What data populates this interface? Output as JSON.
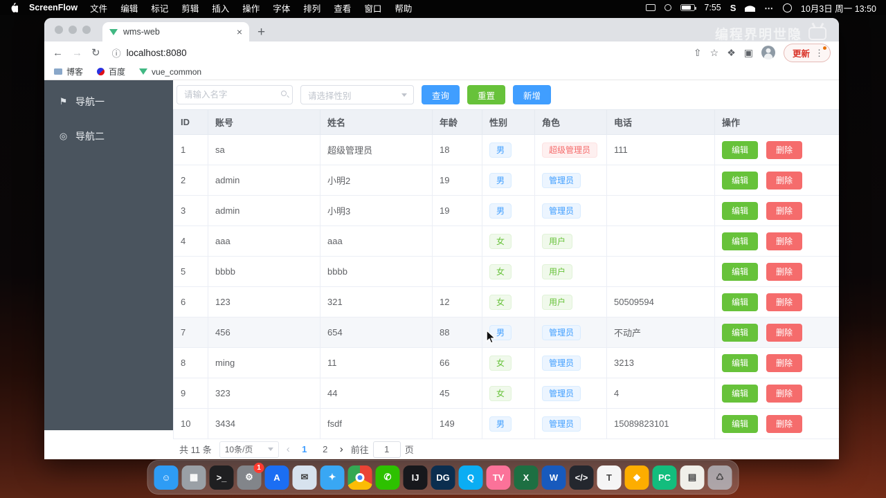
{
  "colors": {
    "primary": "#409eff",
    "success": "#67c23a",
    "danger": "#f56c6c",
    "sidebar_bg": "#4a545e",
    "header_bg": "#eef1f6"
  },
  "menubar": {
    "app_name": "ScreenFlow",
    "menus": [
      "文件",
      "编辑",
      "标记",
      "剪辑",
      "插入",
      "操作",
      "字体",
      "排列",
      "查看",
      "窗口",
      "帮助"
    ],
    "right": {
      "battery_time": "7:55",
      "screenflow_badge": "S",
      "datetime": "10月3日 周一  13:50"
    }
  },
  "browser": {
    "tab": {
      "title": "wms-web"
    },
    "url": "localhost:8080",
    "update_label": "更新",
    "bookmarks": [
      {
        "label": "博客"
      },
      {
        "label": "百度"
      },
      {
        "label": "vue_common"
      }
    ],
    "watermark": "编程界明世隐"
  },
  "sidebar": {
    "items": [
      {
        "label": "导航一",
        "icon": "flag-icon"
      },
      {
        "label": "导航二",
        "icon": "location-icon"
      }
    ]
  },
  "toolbar": {
    "name_placeholder": "请输入名字",
    "gender_placeholder": "请选择性别",
    "search_label": "查询",
    "reset_label": "重置",
    "add_label": "新增"
  },
  "table": {
    "headers": [
      "ID",
      "账号",
      "姓名",
      "年龄",
      "性别",
      "角色",
      "电话",
      "操作"
    ],
    "edit_label": "编辑",
    "delete_label": "删除",
    "rows": [
      {
        "id": "1",
        "account": "sa",
        "name": "超级管理员",
        "age": "18",
        "gender": "男",
        "gender_type": "primary",
        "role": "超级管理员",
        "role_type": "danger",
        "phone": "111"
      },
      {
        "id": "2",
        "account": "admin",
        "name": "小明2",
        "age": "19",
        "gender": "男",
        "gender_type": "primary",
        "role": "管理员",
        "role_type": "primary",
        "phone": ""
      },
      {
        "id": "3",
        "account": "admin",
        "name": "小明3",
        "age": "19",
        "gender": "男",
        "gender_type": "primary",
        "role": "管理员",
        "role_type": "primary",
        "phone": ""
      },
      {
        "id": "4",
        "account": "aaa",
        "name": "aaa",
        "age": "",
        "gender": "女",
        "gender_type": "success",
        "role": "用户",
        "role_type": "success",
        "phone": ""
      },
      {
        "id": "5",
        "account": "bbbb",
        "name": "bbbb",
        "age": "",
        "gender": "女",
        "gender_type": "success",
        "role": "用户",
        "role_type": "success",
        "phone": ""
      },
      {
        "id": "6",
        "account": "123",
        "name": "321",
        "age": "12",
        "gender": "女",
        "gender_type": "success",
        "role": "用户",
        "role_type": "success",
        "phone": "50509594"
      },
      {
        "id": "7",
        "account": "456",
        "name": "654",
        "age": "88",
        "gender": "男",
        "gender_type": "primary",
        "role": "管理员",
        "role_type": "primary",
        "phone": "不动产",
        "hover": true
      },
      {
        "id": "8",
        "account": "ming",
        "name": "11",
        "age": "66",
        "gender": "女",
        "gender_type": "success",
        "role": "管理员",
        "role_type": "primary",
        "phone": "3213"
      },
      {
        "id": "9",
        "account": "323",
        "name": "44",
        "age": "45",
        "gender": "女",
        "gender_type": "success",
        "role": "管理员",
        "role_type": "primary",
        "phone": "4"
      },
      {
        "id": "10",
        "account": "3434",
        "name": "fsdf",
        "age": "149",
        "gender": "男",
        "gender_type": "primary",
        "role": "管理员",
        "role_type": "primary",
        "phone": "15089823101"
      }
    ]
  },
  "pagination": {
    "total_label": "共 11 条",
    "page_size_label": "10条/页",
    "pages": [
      "1",
      "2"
    ],
    "active_page": "1",
    "goto_label": "前往",
    "goto_value": "1",
    "unit_label": "页"
  },
  "dock": {
    "icons": [
      {
        "name": "finder",
        "color": "#2e9cf5",
        "glyph": "☺"
      },
      {
        "name": "launchpad",
        "color": "#9aa0a6",
        "glyph": "▦"
      },
      {
        "name": "terminal",
        "color": "#1f1f21",
        "glyph": ">_"
      },
      {
        "name": "system-preferences",
        "color": "#82858a",
        "glyph": "⚙",
        "badge": "1"
      },
      {
        "name": "app-store",
        "color": "#1b6ef3",
        "glyph": "A"
      },
      {
        "name": "mail",
        "color": "#d7e2ee",
        "glyph": "✉",
        "light": true
      },
      {
        "name": "safari",
        "color": "#39a7f4",
        "glyph": "✦"
      },
      {
        "name": "chrome",
        "color": "",
        "glyph": ""
      },
      {
        "name": "wechat",
        "color": "#2dc100",
        "glyph": "✆"
      },
      {
        "name": "intellij-idea",
        "color": "#17181c",
        "glyph": "IJ"
      },
      {
        "name": "datagrip",
        "color": "#0b2e4f",
        "glyph": "DG"
      },
      {
        "name": "qq",
        "color": "#0badf3",
        "glyph": "Q"
      },
      {
        "name": "bilibili",
        "color": "#fb7299",
        "glyph": "TV"
      },
      {
        "name": "excel",
        "color": "#1d6f42",
        "glyph": "X"
      },
      {
        "name": "word",
        "color": "#185abd",
        "glyph": "W"
      },
      {
        "name": "vscode",
        "color": "#24272e",
        "glyph": "</>"
      },
      {
        "name": "typora",
        "color": "#f5f5f5",
        "glyph": "T",
        "light": true
      },
      {
        "name": "sketch",
        "color": "#fdad00",
        "glyph": "◆"
      },
      {
        "name": "pycharm",
        "color": "#13bd7d",
        "glyph": "PC"
      },
      {
        "name": "notes",
        "color": "#f0efe9",
        "glyph": "▤",
        "light": true
      },
      {
        "name": "trash",
        "color": "rgba(185,189,196,0.78)",
        "glyph": "♺",
        "light": true
      }
    ]
  }
}
